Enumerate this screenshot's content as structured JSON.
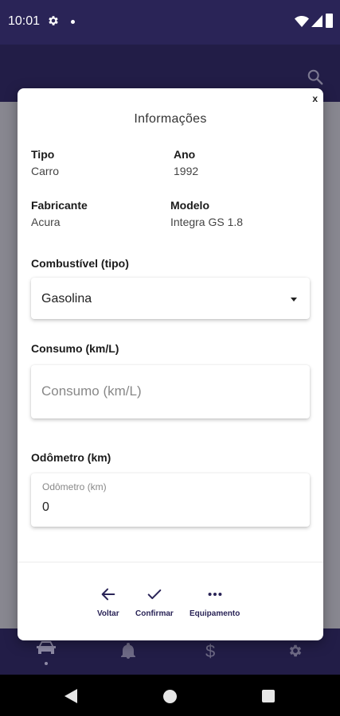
{
  "status_bar": {
    "time": "10:01"
  },
  "modal": {
    "title": "Informações",
    "close_label": "x",
    "info": {
      "tipo_label": "Tipo",
      "tipo_value": "Carro",
      "ano_label": "Ano",
      "ano_value": "1992",
      "fabricante_label": "Fabricante",
      "fabricante_value": "Acura",
      "modelo_label": "Modelo",
      "modelo_value": "Integra GS 1.8"
    },
    "fuel": {
      "label": "Combustível (tipo)",
      "selected": "Gasolina"
    },
    "consumption": {
      "label": "Consumo (km/L)",
      "placeholder": "Consumo (km/L)",
      "value": ""
    },
    "odometer": {
      "label": "Odômetro (km)",
      "floating_label": "Odômetro (km)",
      "value": "0"
    },
    "actions": {
      "back": "Voltar",
      "confirm": "Confirmar",
      "equipment": "Equipamento"
    }
  },
  "colors": {
    "brand": "#2a2457",
    "brand_dark": "#221d47",
    "overlay": "#888790"
  },
  "icons": [
    "settings-icon",
    "search-icon",
    "car-icon",
    "bell-icon",
    "dollar-icon",
    "arrow-left-icon",
    "check-icon",
    "more-horizontal-icon"
  ]
}
